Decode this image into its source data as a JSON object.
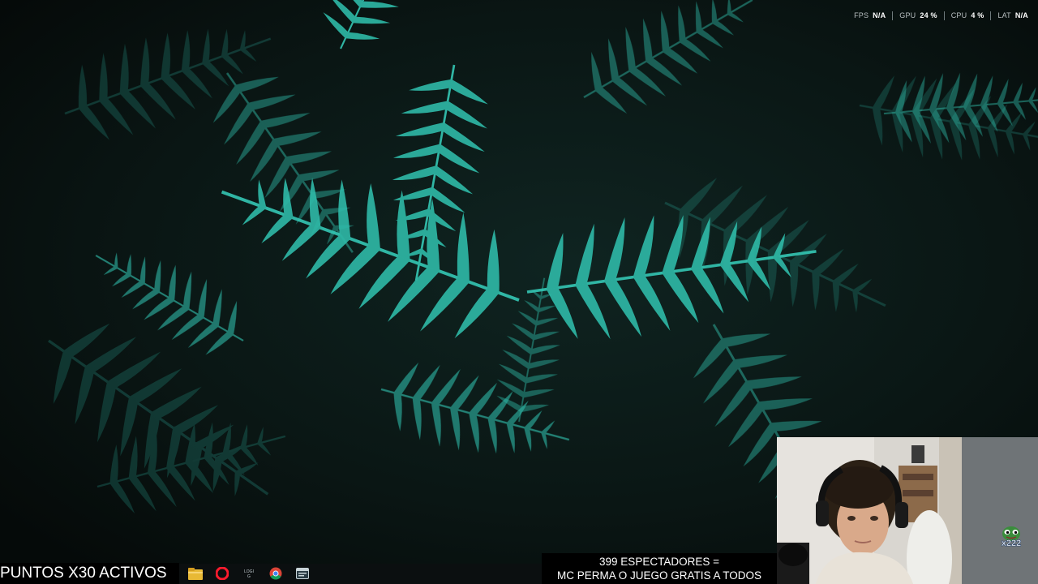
{
  "overlay": {
    "performance": [
      {
        "label": "FPS",
        "value": "N/A"
      },
      {
        "label": "GPU",
        "value": "24 %"
      },
      {
        "label": "CPU",
        "value": "4 %"
      },
      {
        "label": "LAT",
        "value": "N/A"
      }
    ],
    "points_banner": "PUNTOS X30 ACTIVOS",
    "viewer_banner": {
      "line1": "399 ESPECTADORES =",
      "line2": "MC PERMA O JUEGO GRATIS A TODOS"
    },
    "webcam_badge": "x222"
  },
  "taskbar": {
    "icons": [
      "file-explorer-icon",
      "opera-icon",
      "logitech-icon",
      "chrome-icon",
      "app-window-icon"
    ]
  },
  "colors": {
    "wallpaper_dark": "#08110f",
    "fern_accent": "#2ec4b0",
    "taskbar": "#0b0f10"
  }
}
